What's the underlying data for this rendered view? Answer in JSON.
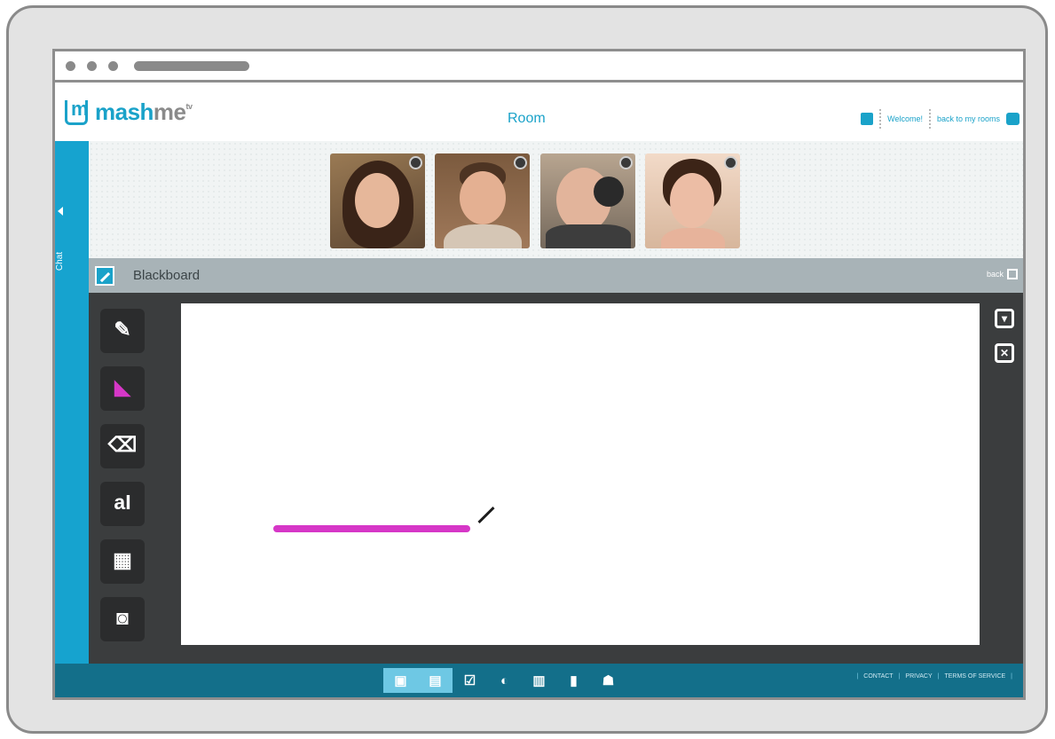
{
  "app": {
    "logo": {
      "mark": "m",
      "name_main": "mash",
      "name_accent": "me",
      "suffix": "tv"
    },
    "room_title": "Room",
    "header": {
      "welcome": "Welcome!",
      "back_to_rooms": "back to my rooms"
    }
  },
  "chat": {
    "label": "Chat"
  },
  "participants": [
    {
      "name": "participant-1",
      "badge_icon": "camera-badge-icon"
    },
    {
      "name": "participant-2",
      "badge_icon": "camera-badge-icon"
    },
    {
      "name": "participant-3",
      "badge_icon": "camera-badge-icon"
    },
    {
      "name": "participant-4",
      "badge_icon": "camera-badge-icon"
    }
  ],
  "blackboard": {
    "title": "Blackboard",
    "back_label": "back",
    "tools": [
      {
        "name": "brush-tool",
        "icon": "brush-icon",
        "glyph": "✎"
      },
      {
        "name": "color-tool",
        "icon": "color-palette-icon",
        "glyph": "◣"
      },
      {
        "name": "eraser-tool",
        "icon": "eraser-icon",
        "glyph": "⌫"
      },
      {
        "name": "text-tool",
        "icon": "text-icon",
        "glyph": "aI"
      },
      {
        "name": "shapes-tool",
        "icon": "shapes-icon",
        "glyph": "▦"
      },
      {
        "name": "snapshot-tool",
        "icon": "camera-icon",
        "glyph": "◙"
      }
    ],
    "stroke_color": "#d637c7",
    "actions": [
      {
        "name": "save-action",
        "icon": "download-icon",
        "glyph": "▾"
      },
      {
        "name": "clear-action",
        "icon": "trash-icon",
        "glyph": "✕"
      }
    ]
  },
  "dock": [
    {
      "name": "dock-lock",
      "icon": "lock-icon",
      "glyph": "▣",
      "active": true
    },
    {
      "name": "dock-notes",
      "icon": "notes-icon",
      "glyph": "▤",
      "active": true
    },
    {
      "name": "dock-blackboard",
      "icon": "blackboard-icon",
      "glyph": "☑",
      "active": false
    },
    {
      "name": "dock-browser",
      "icon": "globe-icon",
      "glyph": "◐",
      "active": false
    },
    {
      "name": "dock-media",
      "icon": "film-icon",
      "glyph": "▥",
      "active": false
    },
    {
      "name": "dock-stats",
      "icon": "bar-chart-icon",
      "glyph": "▮",
      "active": false
    },
    {
      "name": "dock-invite",
      "icon": "add-user-icon",
      "glyph": "☗",
      "active": false
    }
  ],
  "footer": {
    "contact": "CONTACT",
    "privacy": "PRIVACY",
    "terms": "TERMS OF SERVICE"
  },
  "colors": {
    "accent": "#1aa2c9",
    "footer_bg": "#136f8a",
    "workspace_bg": "#3b3d3e"
  }
}
